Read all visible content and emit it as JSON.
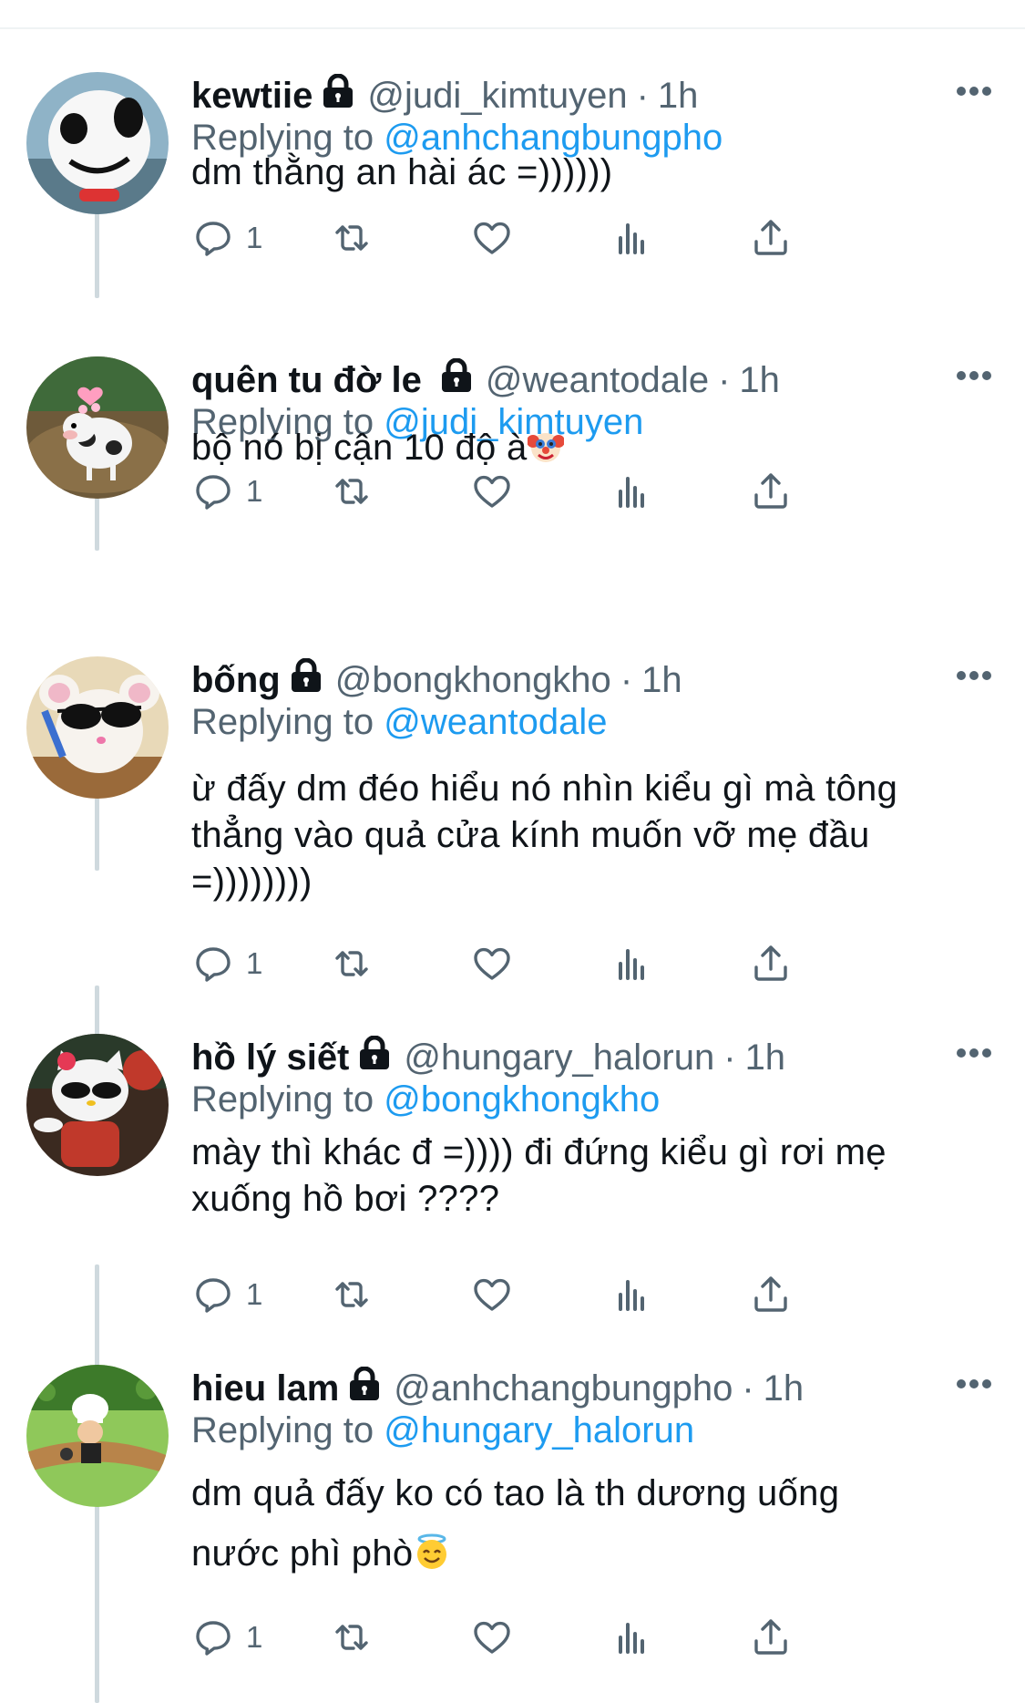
{
  "replying_prefix": "Replying to ",
  "tweets": [
    {
      "name": "kewtiie",
      "handle": "@judi_kimtuyen",
      "time": "1h",
      "reply_to": "@anhchangbungpho",
      "text": "dm thằng an hài ác =))))))",
      "reply_count": "1",
      "avatar": "cartoon-dog-avatar"
    },
    {
      "name": "quên tu đờ le",
      "handle": "@weantodale",
      "time": "1h",
      "reply_to": "@judi_kimtuyen",
      "text": "bộ nó bị cận 10 độ à",
      "text_emoji": "clown-face-emoji",
      "reply_count": "1",
      "avatar": "cartoon-cow-avatar"
    },
    {
      "name": "bống",
      "handle": "@bongkhongkho",
      "time": "1h",
      "reply_to": "@weantodale",
      "text_lines": [
        "ừ đấy dm đéo hiểu nó nhìn kiểu gì mà tông",
        "thẳng vào quả cửa kính muốn vỡ mẹ đầu",
        "=))))))))"
      ],
      "reply_count": "1",
      "avatar": "hamster-sunglasses-avatar"
    },
    {
      "name": "hồ lý siết",
      "handle": "@hungary_halorun",
      "time": "1h",
      "reply_to": "@bongkhongkho",
      "text_lines": [
        "mày thì khác đ =)))) đi đứng kiểu gì rơi mẹ",
        "xuống hồ bơi ????"
      ],
      "reply_count": "1",
      "avatar": "kitty-sunglasses-avatar"
    },
    {
      "name": "hieu lam",
      "handle": "@anhchangbungpho",
      "time": "1h",
      "reply_to": "@hungary_halorun",
      "text_lines": [
        "dm quả đấy ko có tao là th dương uống",
        "nước phì phò"
      ],
      "text_emoji": "smiling-face-with-halo-emoji",
      "reply_count": "1",
      "avatar": "chef-game-avatar"
    }
  ],
  "colors": {
    "link": "#1d9bf0",
    "secondary": "#536471",
    "thread_line": "#cfd9de"
  }
}
